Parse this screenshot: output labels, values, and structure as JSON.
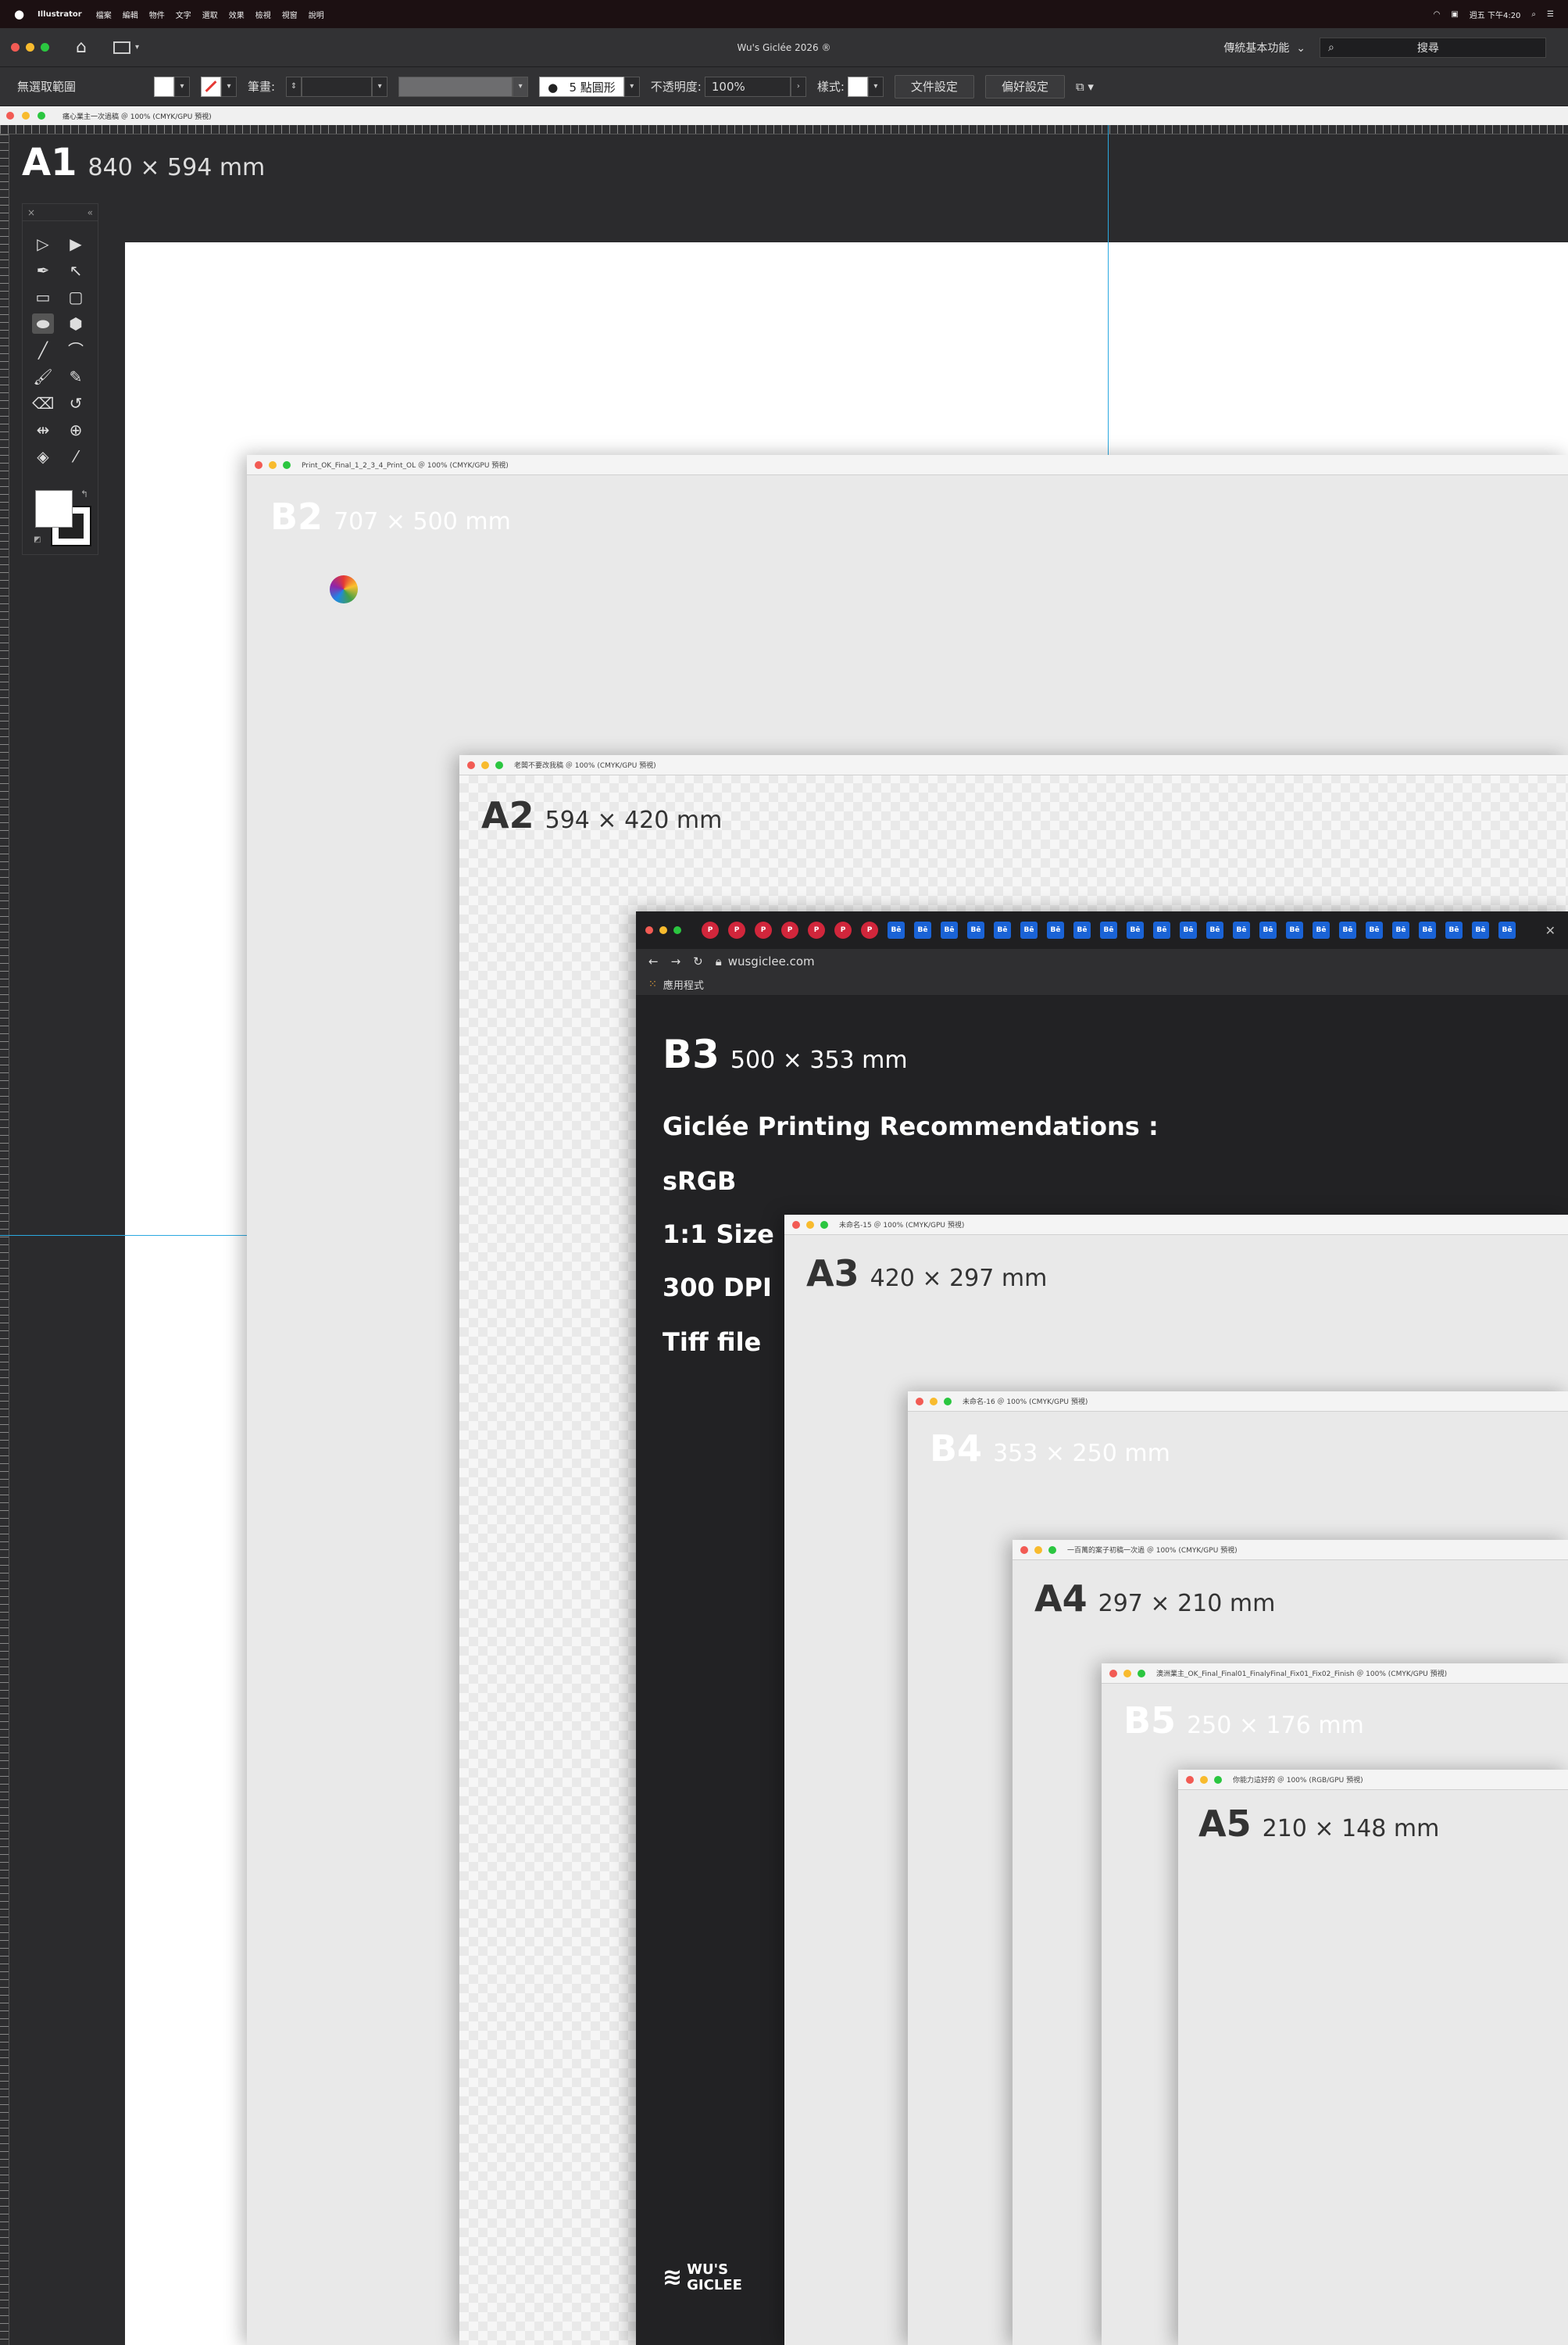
{
  "menubar": {
    "app": "Illustrator",
    "items": [
      "檔案",
      "編輯",
      "物件",
      "文字",
      "選取",
      "效果",
      "檢視",
      "視窗",
      "說明"
    ],
    "clock": "週五 下午4:20"
  },
  "appbar": {
    "title": "Wu's Giclée 2026 ®",
    "workspace": "傳統基本功能",
    "search": "搜尋"
  },
  "controlbar": {
    "selection": "無選取範圍",
    "stroke_label": "筆畫:",
    "brush": "5 點圓形",
    "opacity_label": "不透明度:",
    "opacity": "100%",
    "style_label": "樣式:",
    "doc_setup": "文件設定",
    "preferences": "偏好設定"
  },
  "doctab": {
    "title": "痛心業主一次過稿 ＠ 100% (CMYK/GPU 預視)"
  },
  "artboards": {
    "a1": {
      "code": "A1",
      "dims": "840 × 594 mm"
    },
    "b2": {
      "code": "B2",
      "dims": "707 × 500 mm",
      "title": "Print_OK_Final_1_2_3_4_Print_OL ＠ 100% (CMYK/GPU 預視)"
    },
    "a2": {
      "code": "A2",
      "dims": "594 × 420 mm",
      "title": "老闆不要改我稿 ＠ 100% (CMYK/GPU 預視)"
    },
    "a3": {
      "code": "A3",
      "dims": "420 × 297 mm",
      "title": "未命名-15 ＠ 100% (CMYK/GPU 預視)"
    },
    "b4": {
      "code": "B4",
      "dims": "353 × 250 mm",
      "title": "未命名-16 ＠ 100% (CMYK/GPU 預視)"
    },
    "a4": {
      "code": "A4",
      "dims": "297 × 210 mm",
      "title": "一百萬的案子初稿一次過 ＠ 100% (CMYK/GPU 預視)"
    },
    "b5": {
      "code": "B5",
      "dims": "250 × 176 mm",
      "title": "澳洲業主_OK_Final_Final01_FinalyFinal_Fix01_Fix02_Finish ＠ 100% (CMYK/GPU 預視)"
    },
    "a5": {
      "code": "A5",
      "dims": "210 × 148 mm",
      "title": "你能力這好的 ＠ 100% (RGB/GPU 預視)"
    }
  },
  "browser": {
    "url": "wusgiclee.com",
    "bookmarks": "應用程式",
    "code": "B3",
    "dims": "500 × 353 mm",
    "heading": "Giclée Printing Recommendations :",
    "recommendations": [
      "sRGB",
      "1:1 Size",
      "300 DPI",
      "Tiff file"
    ],
    "logo_line1": "WU'S",
    "logo_line2": "GICLEE",
    "pinterest_tab": "P",
    "behance_tab": "Bē"
  },
  "colors": {
    "guide": "#2ba9e0",
    "dark_bg": "#2b2b2d",
    "window_gray": "#e9e9e9"
  }
}
